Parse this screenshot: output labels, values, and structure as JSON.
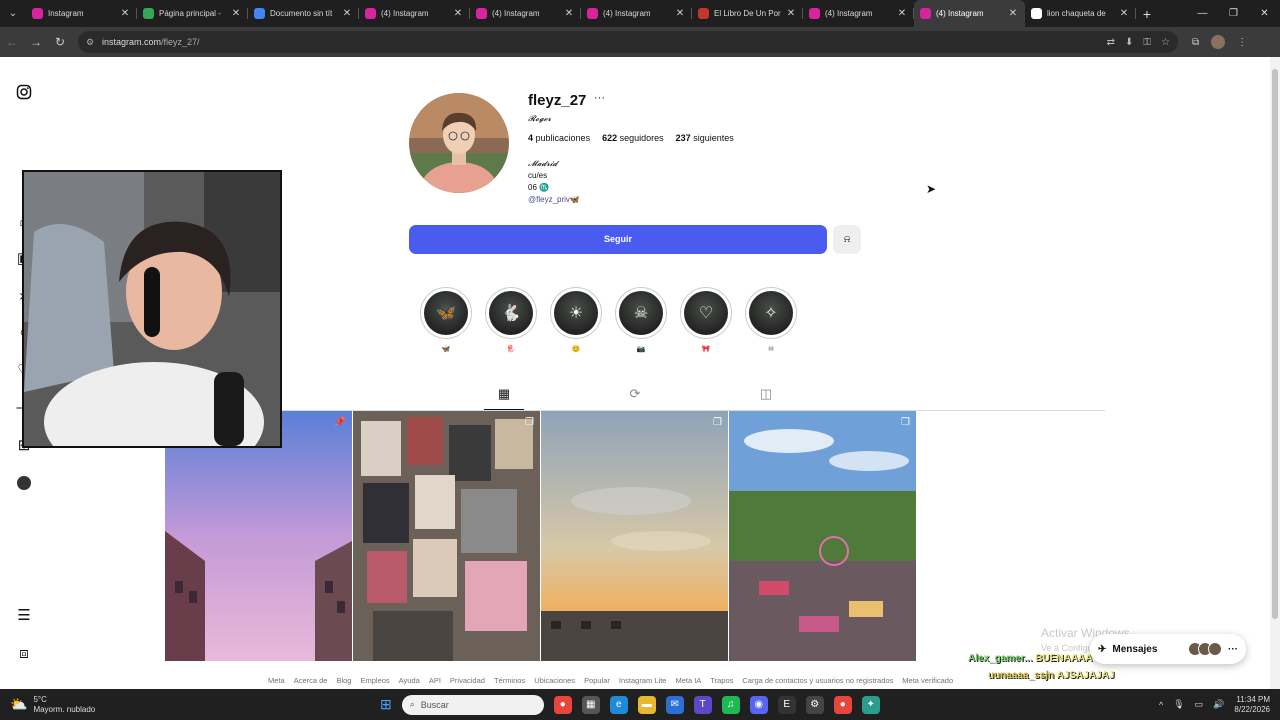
{
  "browser": {
    "tabs": [
      {
        "title": "Instagram",
        "color": "#d6249f"
      },
      {
        "title": "Página principal -",
        "color": "#34a853"
      },
      {
        "title": "Documento sin tít",
        "color": "#4285f4"
      },
      {
        "title": "(4) Instagram",
        "color": "#d6249f"
      },
      {
        "title": "(4) Instagram",
        "color": "#d6249f"
      },
      {
        "title": "(4) Instagram",
        "color": "#d6249f"
      },
      {
        "title": "El Libro De Un Por",
        "color": "#c0392b"
      },
      {
        "title": "(4) Instagram",
        "color": "#d6249f"
      },
      {
        "title": "(4) Instagram",
        "color": "#d6249f"
      },
      {
        "title": "lion chaqueta de",
        "color": "#ffffff"
      }
    ],
    "active_tab": 8,
    "url_host": "instagram.com",
    "url_path": "/fleyz_27/"
  },
  "profile": {
    "username": "fleyz_27",
    "full_name": "𝓡𝓸𝓰𝓮𝓻",
    "posts_count": "4",
    "posts_label": "publicaciones",
    "followers_count": "622",
    "followers_label": "seguidores",
    "following_count": "237",
    "following_label": "siguientes",
    "bio_city": "𝓜𝓪𝓭𝓻𝓲𝓭",
    "bio_line2": "cu/es",
    "bio_line3": "06 ♏",
    "bio_link": "@fleyz_priv🦋",
    "follow_label": "Seguir"
  },
  "highlights": [
    {
      "icon": "butterfly-icon",
      "glyph": "🦋",
      "label": "🦋"
    },
    {
      "icon": "bunny-icon",
      "glyph": "🐇",
      "label": "🪼"
    },
    {
      "icon": "sun-icon",
      "glyph": "☀",
      "label": "😊"
    },
    {
      "icon": "skull-icon",
      "glyph": "☠",
      "label": "📷"
    },
    {
      "icon": "heart-icon",
      "glyph": "♡",
      "label": "🎀"
    },
    {
      "icon": "fairy-icon",
      "glyph": "✧",
      "label": "♾"
    }
  ],
  "footer_links": [
    "Meta",
    "Acerca de",
    "Blog",
    "Empleos",
    "Ayuda",
    "API",
    "Privacidad",
    "Términos",
    "Ubicaciones",
    "Popular",
    "Instagram Lite",
    "Meta IA",
    "Trapos",
    "Carga de contactos y usuarios no registrados",
    "Meta verificado"
  ],
  "overlay": {
    "activate_title": "Activar Windows",
    "activate_sub": "Ve a Configu",
    "messages_label": "Mensajes",
    "chat": [
      {
        "name": "Alex_gamer...",
        "text": "BUENAAAA"
      },
      {
        "name": "uunaaaa_ssjn",
        "text": "AJSAJAJAJ"
      }
    ]
  },
  "taskbar": {
    "temp": "5°C",
    "weather": "Mayorm. nublado",
    "search_placeholder": "Buscar",
    "time": "11:34 PM",
    "date": "8/22/2026"
  }
}
